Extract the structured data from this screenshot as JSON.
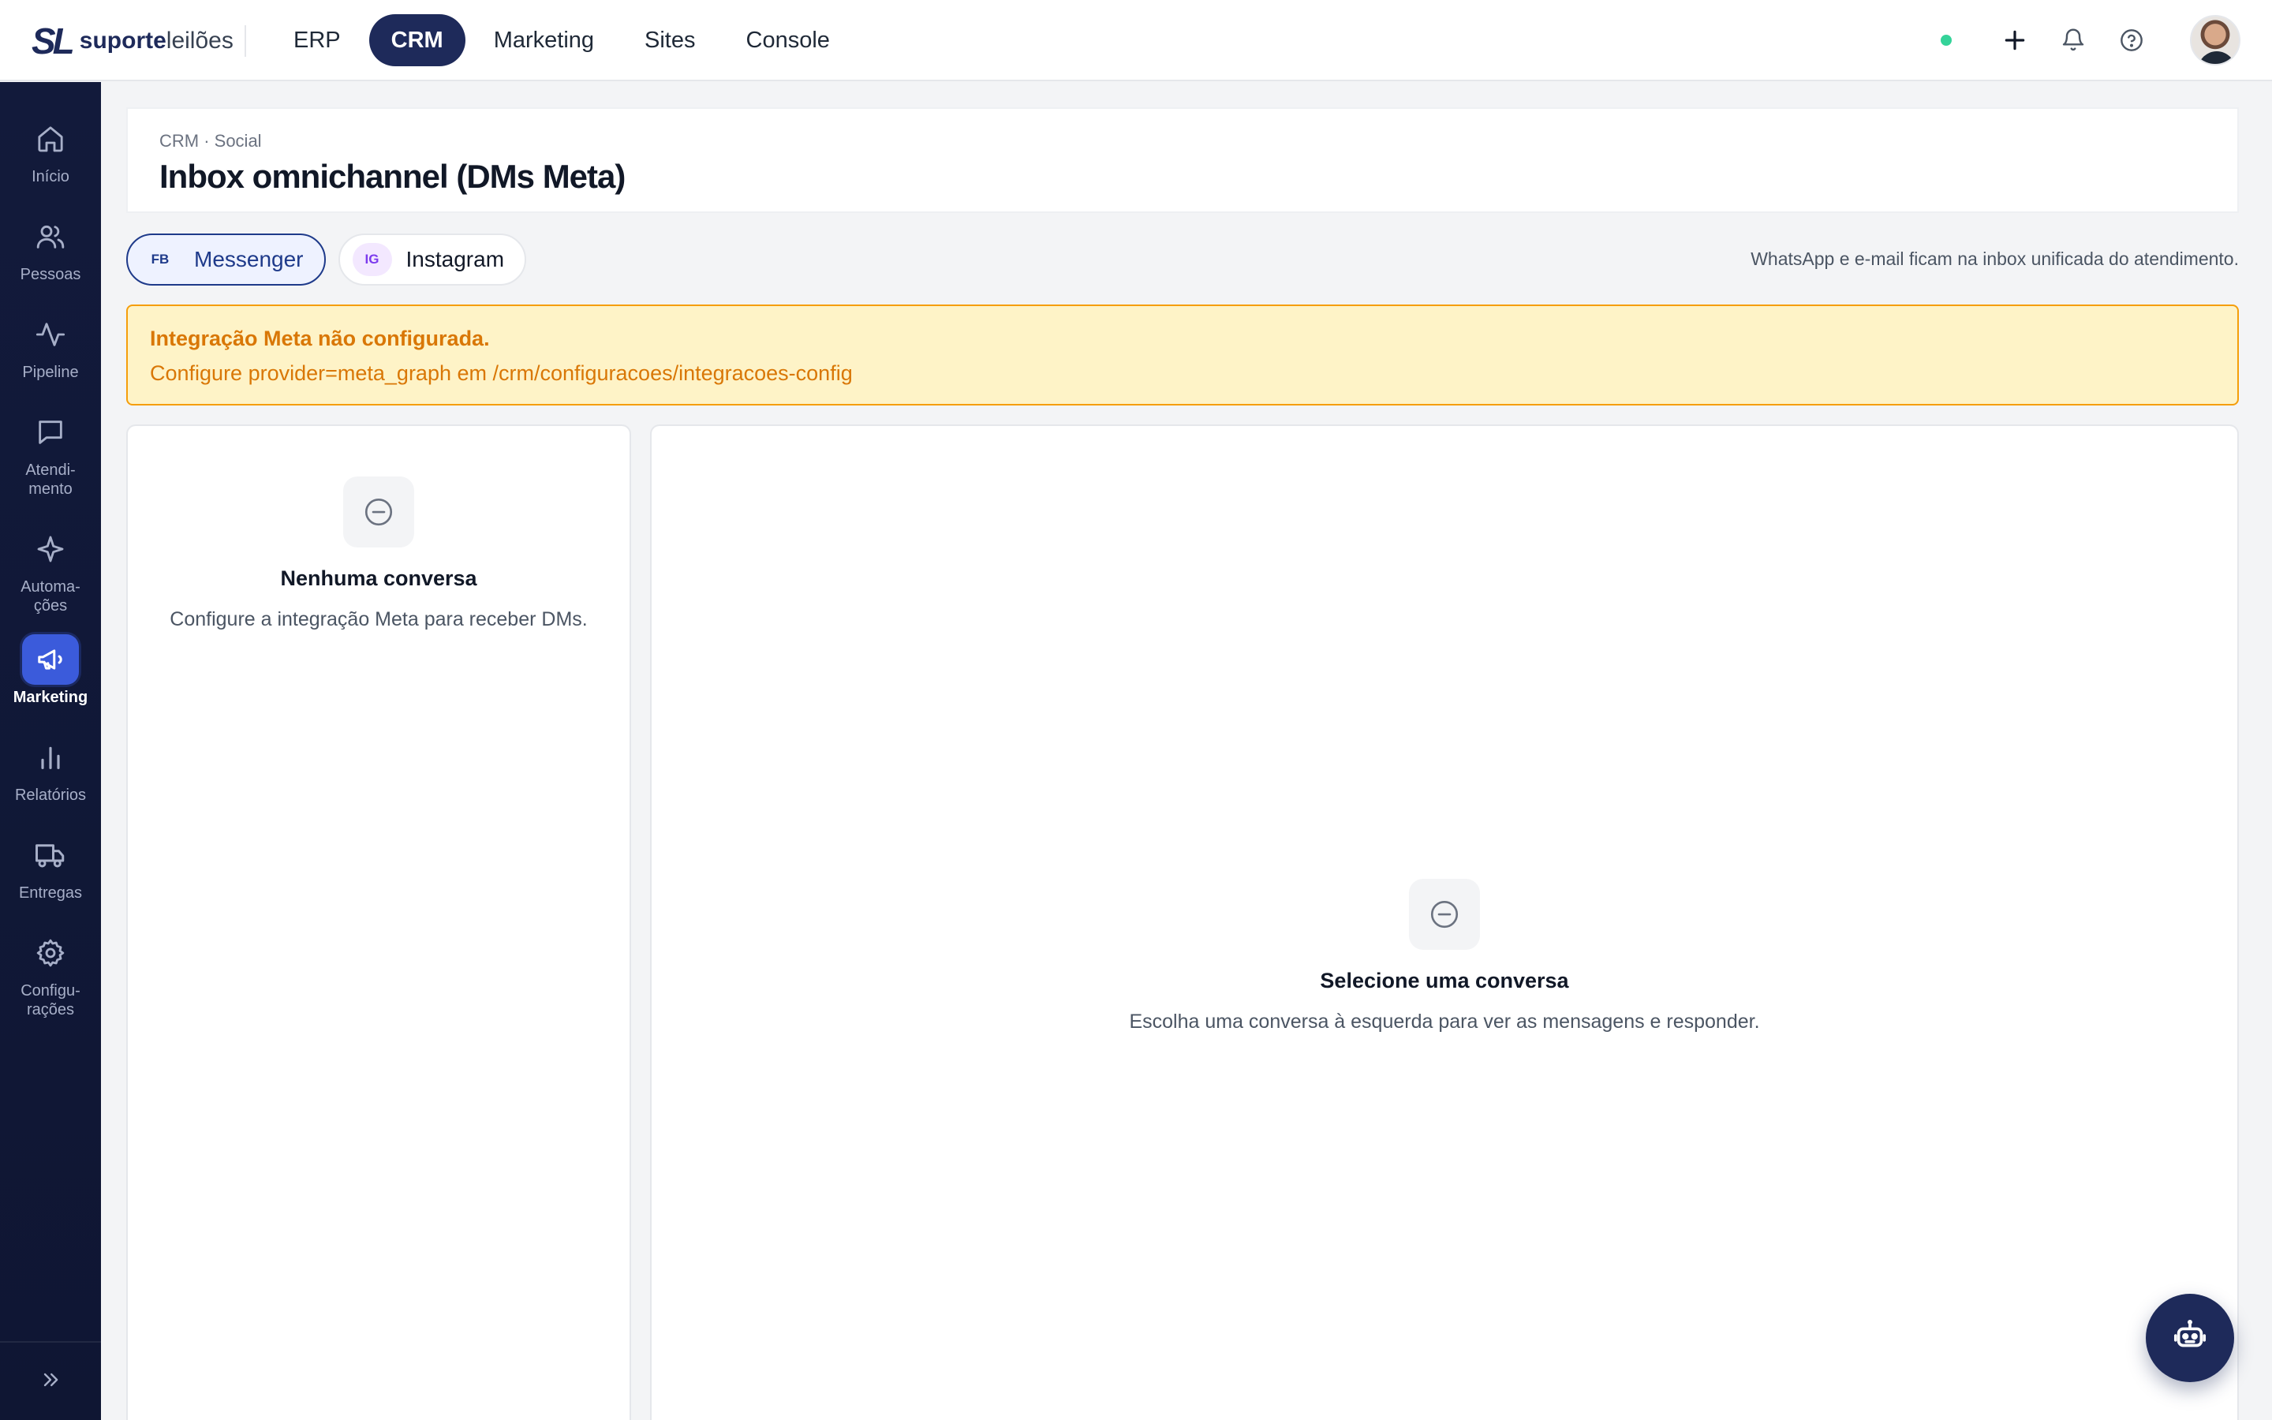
{
  "brand": {
    "mark": "SL",
    "name_bold": "suporte",
    "name_light": "leilões"
  },
  "topnav": {
    "items": [
      {
        "label": "ERP",
        "active": false
      },
      {
        "label": "CRM",
        "active": true
      },
      {
        "label": "Marketing",
        "active": false
      },
      {
        "label": "Sites",
        "active": false
      },
      {
        "label": "Console",
        "active": false
      }
    ]
  },
  "topbar_icons": [
    "status-online-icon",
    "plus-icon",
    "bell-icon",
    "help-icon",
    "user-avatar"
  ],
  "sidebar": {
    "items": [
      {
        "label": "Início",
        "icon": "home-icon",
        "active": false
      },
      {
        "label": "Pessoas",
        "icon": "users-icon",
        "active": false
      },
      {
        "label": "Pipeline",
        "icon": "activity-icon",
        "active": false
      },
      {
        "label": "Atendi-\nmento",
        "icon": "chat-icon",
        "active": false
      },
      {
        "label": "Automa-\nções",
        "icon": "sparkle-icon",
        "active": false
      },
      {
        "label": "Marketing",
        "icon": "megaphone-icon",
        "active": true
      },
      {
        "label": "Relatórios",
        "icon": "bar-chart-icon",
        "active": false
      },
      {
        "label": "Entregas",
        "icon": "truck-icon",
        "active": false
      },
      {
        "label": "Configu-\nrações",
        "icon": "gear-icon",
        "active": false
      }
    ],
    "collapse_icon": "chevrons-right-icon"
  },
  "header": {
    "breadcrumb": "CRM · Social",
    "title": "Inbox omnichannel (DMs Meta)"
  },
  "channels": {
    "tabs": [
      {
        "badge": "FB",
        "label": "Messenger",
        "active": true
      },
      {
        "badge": "IG",
        "label": "Instagram",
        "active": false
      }
    ],
    "note": "WhatsApp e e-mail ficam na inbox unificada do atendimento."
  },
  "alert": {
    "title": "Integração Meta não configurada.",
    "text": "Configure provider=meta_graph em /crm/configuracoes/integracoes-config"
  },
  "conversation_list": {
    "empty_icon": "minus-circle-icon",
    "empty_title": "Nenhuma conversa",
    "empty_text": "Configure a integração Meta para receber DMs."
  },
  "conversation_view": {
    "empty_icon": "minus-circle-icon",
    "empty_title": "Selecione uma conversa",
    "empty_text": "Escolha uma conversa à esquerda para ver as mensagens e responder."
  },
  "fab": {
    "icon": "bot-icon"
  },
  "colors": {
    "navy": "#1e2a5a",
    "sidebar_bg": "#121a3b",
    "sidebar_active": "#3b5bdb",
    "alert_bg": "#fef3c7",
    "alert_border": "#f59e0b",
    "alert_text": "#d97706",
    "status_online": "#34d399"
  }
}
